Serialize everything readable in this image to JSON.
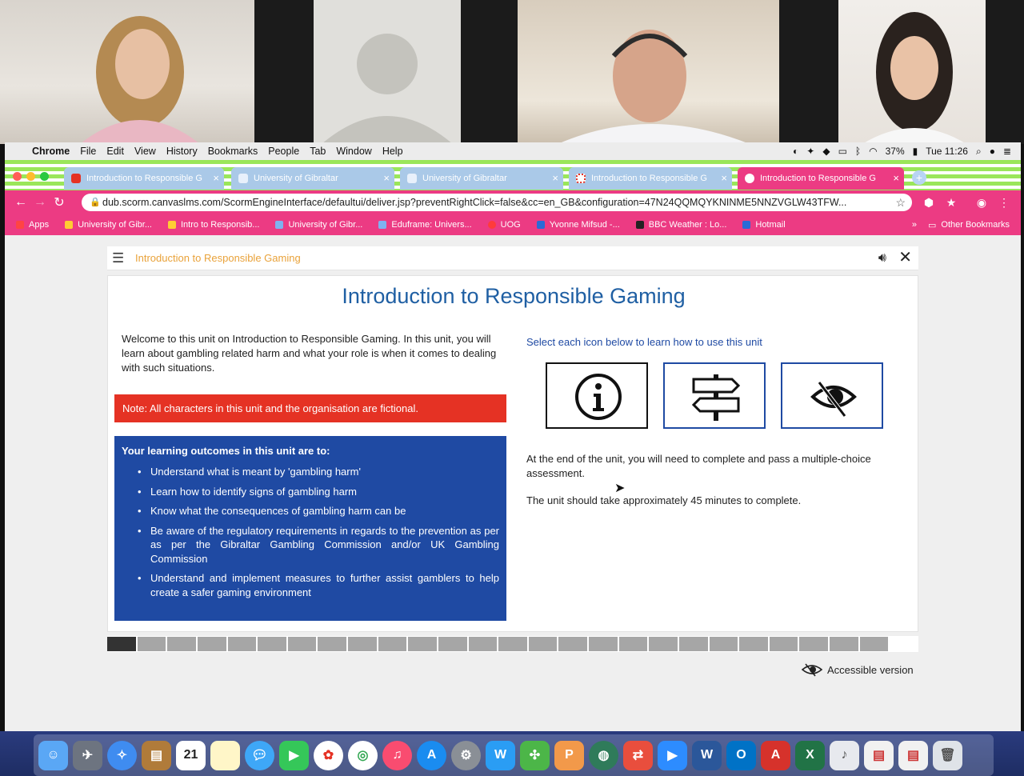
{
  "menubar": {
    "app": "Chrome",
    "items": [
      "File",
      "Edit",
      "View",
      "History",
      "Bookmarks",
      "People",
      "Tab",
      "Window",
      "Help"
    ],
    "battery": "37%",
    "clock": "Tue 11:26"
  },
  "tabs": [
    {
      "title": "Introduction to Responsible G",
      "color": "#aac9e8"
    },
    {
      "title": "University of Gibraltar",
      "color": "#aac9e8"
    },
    {
      "title": "University of Gibraltar",
      "color": "#aac9e8"
    },
    {
      "title": "Introduction to Responsible G",
      "color": "#aac9e8"
    },
    {
      "title": "Introduction to Responsible G",
      "color": "#ec3b83"
    }
  ],
  "address": {
    "url": "dub.scorm.canvaslms.com/ScormEngineInterface/defaultui/deliver.jsp?preventRightClick=false&cc=en_GB&configuration=47N24QQMQYKNINME5NNZVGLW43TFW..."
  },
  "bookmarks": [
    {
      "label": "Apps",
      "color": "#f44"
    },
    {
      "label": "University of Gibr...",
      "color": "#ffcc33"
    },
    {
      "label": "Intro to Responsib...",
      "color": "#ffcc33"
    },
    {
      "label": "University of Gibr...",
      "color": "#7fb2f0"
    },
    {
      "label": "Eduframe: Univers...",
      "color": "#7fb2f0"
    },
    {
      "label": "UOG",
      "color": "#ff3b3b"
    },
    {
      "label": "Yvonne Mifsud -...",
      "color": "#2a6ad6"
    },
    {
      "label": "BBC Weather : Lo...",
      "color": "#222"
    },
    {
      "label": "Hotmail",
      "color": "#2a6ad6"
    }
  ],
  "bookmarks_more": "»",
  "other_bookmarks": "Other Bookmarks",
  "course": {
    "bar_title": "Introduction to Responsible Gaming",
    "heading": "Introduction to Responsible Gaming",
    "intro": "Welcome to this unit on Introduction to Responsible Gaming. In this unit, you will learn about gambling related harm and what your role is when it comes to dealing with such situations.",
    "note": "Note: All characters in this unit and the organisation are fictional.",
    "outcomes_heading": "Your learning outcomes in this unit are to:",
    "outcomes": [
      "Understand what is meant by 'gambling harm'",
      "Learn how to identify signs of gambling harm",
      "Know what the consequences of gambling harm can be",
      "Be aware of the regulatory requirements in regards to the prevention as per as per the Gibraltar Gambling Commission and/or UK Gambling Commission",
      "Understand and implement measures to further assist gamblers to help create a safer gaming environment"
    ],
    "select_prompt": "Select each icon below to learn how to use this unit",
    "icon_buttons": [
      "info-icon",
      "signpost-icon",
      "eye-slash-icon"
    ],
    "assessment": "At the end of the unit,  you will need to complete and pass a multiple-choice assessment.",
    "duration": "The unit should take approximately 45 minutes to complete.",
    "accessible_label": "Accessible version",
    "progress": {
      "completed": 1,
      "total": 27
    }
  },
  "dock": {
    "date_badge": "21"
  },
  "colors": {
    "accent_pink": "#ec3b83",
    "heading_blue": "#1f5fa3",
    "outcomes_blue": "#1f4aa3",
    "note_red": "#e53224",
    "course_bar_orange": "#e9a23a"
  }
}
